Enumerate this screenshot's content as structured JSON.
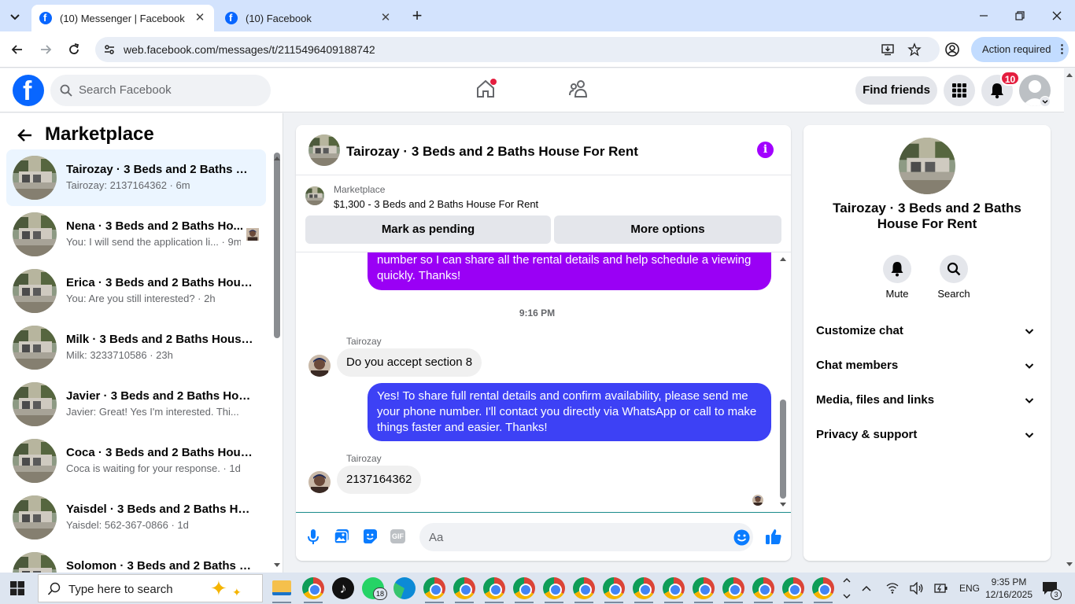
{
  "browser": {
    "tabs": [
      {
        "title": "(10) Messenger | Facebook",
        "active": true
      },
      {
        "title": "(10) Facebook",
        "active": false
      }
    ],
    "url": "web.facebook.com/messages/t/2115496409188742",
    "action_required": "Action required"
  },
  "fb": {
    "search_placeholder": "Search Facebook",
    "find_friends": "Find friends",
    "notification_count": "10"
  },
  "sidebar": {
    "title": "Marketplace",
    "conversations": [
      {
        "name": "Tairozay · 3 Beds and 2 Baths Ho...",
        "preview": "Tairozay: 2137164362 · 6m",
        "active": true
      },
      {
        "name": "Nena · 3 Beds and 2 Baths Ho...",
        "preview": "You: I will send the application li... · 9m",
        "active": false
      },
      {
        "name": "Erica · 3 Beds and 2 Baths House...",
        "preview": "You: Are you still interested? · 2h",
        "active": false
      },
      {
        "name": "Milk · 3 Beds and 2 Baths House...",
        "preview": "Milk: 3233710586 · 23h",
        "active": false
      },
      {
        "name": "Javier · 3 Beds and 2 Baths Hous...",
        "preview": "Javier: Great! Yes I'm interested. Thi... · 1d",
        "active": false
      },
      {
        "name": "Coca · 3 Beds and 2 Baths Hous...",
        "preview": "Coca is waiting for your response. · 1d",
        "active": false
      },
      {
        "name": "Yaisdel · 3 Beds and 2 Baths Hou...",
        "preview": "Yaisdel: 562-367-0866 · 1d",
        "active": false
      },
      {
        "name": "Solomon · 3 Beds and 2 Baths H...",
        "preview": "",
        "active": false
      }
    ]
  },
  "chat": {
    "title": "Tairozay · 3 Beds and 2 Baths House For Rent",
    "marketplace_label": "Marketplace",
    "listing": "$1,300 - 3 Beds and 2 Baths House For Rent",
    "mark_pending": "Mark as pending",
    "more_options": "More options",
    "partial_out_message": "number so I can share all the rental details and help schedule a viewing quickly. Thanks!",
    "timestamp": "9:16 PM",
    "sender_1": "Tairozay",
    "in_message_1": "Do you accept section 8",
    "out_message_2": "Yes! To share full rental details and confirm availability, please send me your phone number. I'll contact you directly via WhatsApp or call to make things faster and easier. Thanks!",
    "sender_2": "Tairozay",
    "in_message_2": "2137164362",
    "composer_placeholder": "Aa"
  },
  "info_panel": {
    "name": "Tairozay · 3 Beds and 2 Baths House For Rent",
    "actions": [
      {
        "label": "Mute",
        "icon": "bell-icon"
      },
      {
        "label": "Search",
        "icon": "search-icon"
      }
    ],
    "sections": [
      "Customize chat",
      "Chat members",
      "Media, files and links",
      "Privacy & support"
    ]
  },
  "taskbar": {
    "search_placeholder": "Type here to search",
    "whatsapp_badge": "18",
    "lang": "ENG",
    "time": "9:35 PM",
    "date": "12/16/2025",
    "notif_count": "3"
  }
}
